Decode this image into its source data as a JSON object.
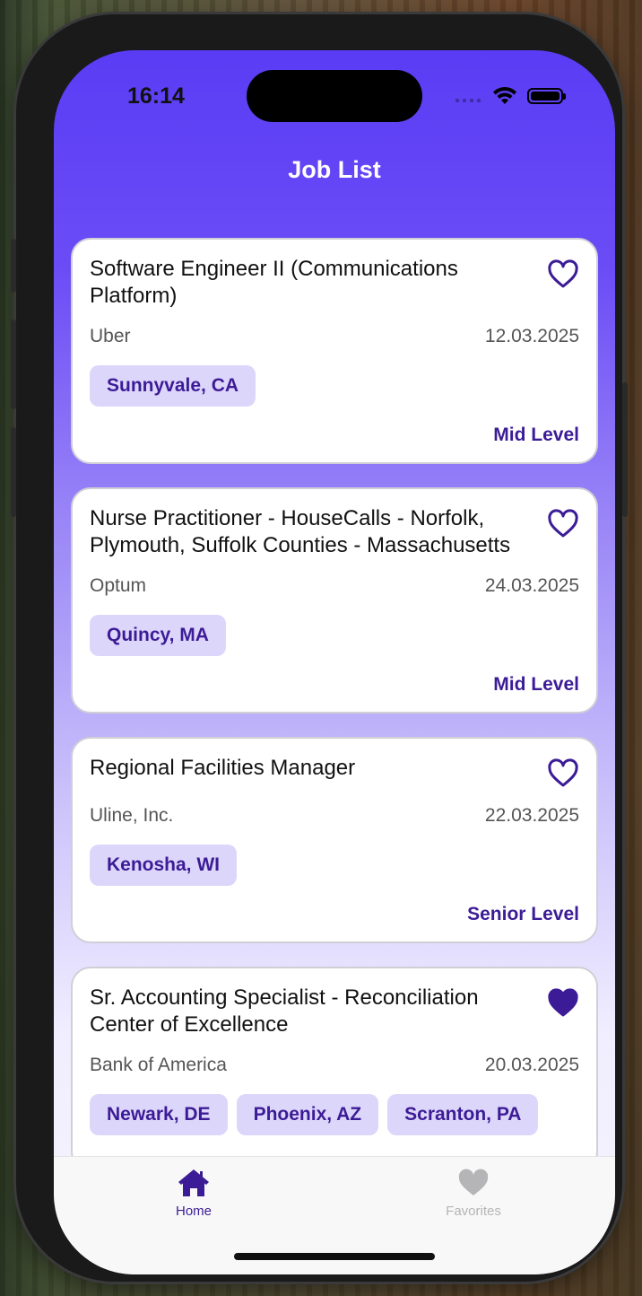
{
  "status_bar": {
    "time": "16:14"
  },
  "header": {
    "title": "Job List"
  },
  "jobs": [
    {
      "title": "Software Engineer II (Communications Platform)",
      "company": "Uber",
      "date": "12.03.2025",
      "locations": [
        "Sunnyvale, CA"
      ],
      "level": "Mid Level",
      "favorited": false
    },
    {
      "title": "Nurse Practitioner - HouseCalls - Norfolk, Plymouth, Suffolk Counties - Massachusetts",
      "company": "Optum",
      "date": "24.03.2025",
      "locations": [
        "Quincy, MA"
      ],
      "level": "Mid Level",
      "favorited": false
    },
    {
      "title": "Regional Facilities Manager",
      "company": "Uline, Inc.",
      "date": "22.03.2025",
      "locations": [
        "Kenosha, WI"
      ],
      "level": "Senior Level",
      "favorited": false
    },
    {
      "title": "Sr. Accounting Specialist - Reconciliation Center of Excellence",
      "company": "Bank of America",
      "date": "20.03.2025",
      "locations": [
        "Newark, DE",
        "Phoenix, AZ",
        "Scranton, PA"
      ],
      "level": "",
      "favorited": true
    }
  ],
  "tabbar": {
    "tabs": [
      {
        "label": "Home",
        "icon": "house-icon",
        "active": true
      },
      {
        "label": "Favorites",
        "icon": "heart-icon",
        "active": false
      }
    ]
  },
  "colors": {
    "accent": "#3c1c96",
    "tag_bg": "#ddd6fb",
    "header_gradient_top": "#5a3cf5",
    "inactive_tab": "#b5b5b8"
  }
}
